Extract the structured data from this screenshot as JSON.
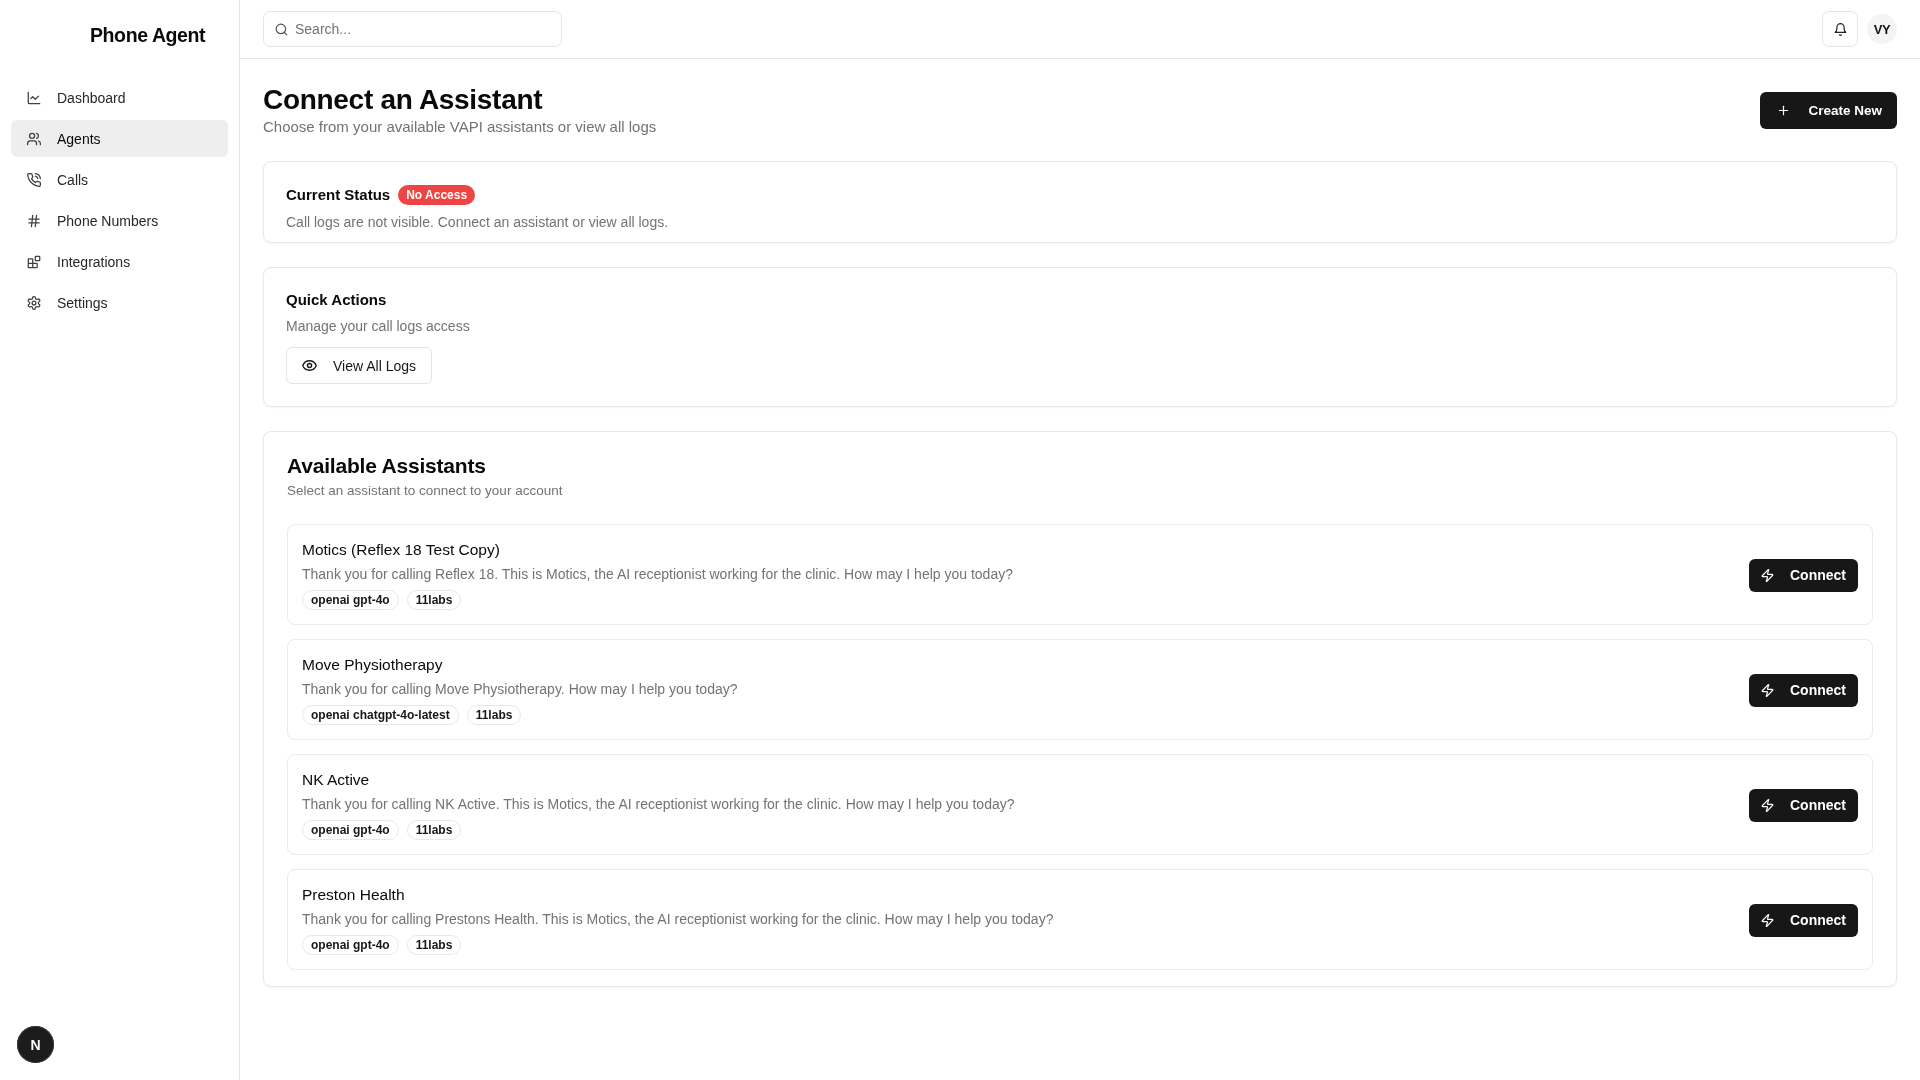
{
  "sidebar": {
    "title": "Phone Agent",
    "items": [
      {
        "label": "Dashboard",
        "selected": false
      },
      {
        "label": "Agents",
        "selected": true
      },
      {
        "label": "Calls",
        "selected": false
      },
      {
        "label": "Phone Numbers",
        "selected": false
      },
      {
        "label": "Integrations",
        "selected": false
      },
      {
        "label": "Settings",
        "selected": false
      }
    ],
    "floating_button": "N"
  },
  "topbar": {
    "search": {
      "placeholder": "Search..."
    },
    "avatar": "VY"
  },
  "header": {
    "title": "Connect an Assistant",
    "subtitle": "Choose from your available VAPI assistants or view all logs",
    "button": "Create New"
  },
  "status_card": {
    "title": "Current Status",
    "badge": "No Access",
    "description": "Call logs are not visible. Connect an assistant or view all logs."
  },
  "quick_actions": {
    "title": "Quick Actions",
    "description": "Manage your call logs access",
    "button": "View All Logs"
  },
  "assistants": {
    "title": "Available Assistants",
    "subtitle": "Select an assistant to connect to your account",
    "items": [
      {
        "name": "Motics (Reflex 18 Test Copy)",
        "greeting": "Thank you for calling Reflex 18. This is Motics, the AI receptionist working for the clinic. How may I help you today?",
        "tags": [
          "openai gpt-4o",
          "11labs"
        ],
        "button": "Connect"
      },
      {
        "name": "Move Physiotherapy",
        "greeting": "Thank you for calling Move Physiotherapy. How may I help you today?",
        "tags": [
          "openai chatgpt-4o-latest",
          "11labs"
        ],
        "button": "Connect"
      },
      {
        "name": "NK Active",
        "greeting": "Thank you for calling NK Active. This is Motics, the AI receptionist working for the clinic. How may I help you today?",
        "tags": [
          "openai gpt-4o",
          "11labs"
        ],
        "button": "Connect"
      },
      {
        "name": "Preston Health",
        "greeting": "Thank you for calling Prestons Health. This is Motics, the AI receptionist working for the clinic. How may I help you today?",
        "tags": [
          "openai gpt-4o",
          "11labs"
        ],
        "button": "Connect"
      }
    ]
  }
}
